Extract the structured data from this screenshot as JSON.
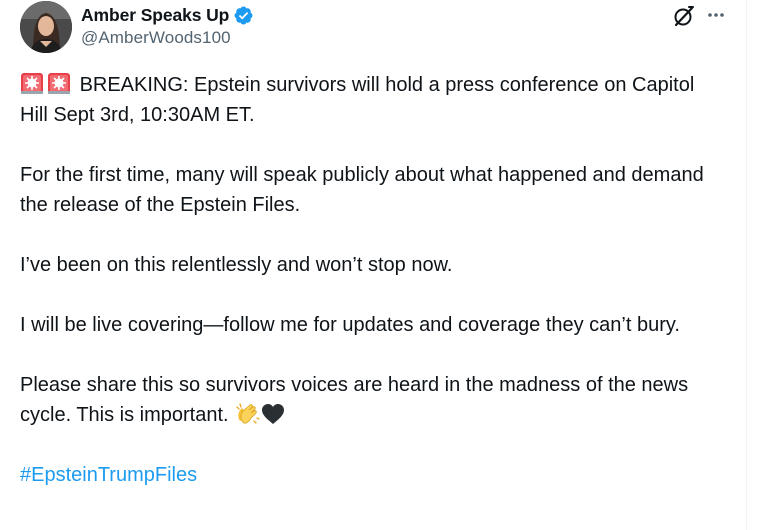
{
  "author": {
    "display_name": "Amber Speaks Up",
    "handle": "@AmberWoods100",
    "verified": true,
    "verified_color": "#1d9bf0"
  },
  "tweet": {
    "paragraphs": [
      "BREAKING: Epstein survivors will hold a press conference on Capitol Hill Sept 3rd, 10:30AM ET.",
      "For the first time, many will speak publicly about what happened and demand the release of the Epstein Files.",
      "I’ve been on this relentlessly and won’t stop now.",
      "I will be live covering—follow me for updates and coverage they can’t bury.",
      "Please share this so survivors voices are heard in the madness of the news cycle. This is important."
    ],
    "hashtag": "#EpsteinTrumpFiles",
    "leading_emoji": [
      "police-light-emoji",
      "police-light-emoji"
    ],
    "trailing_emoji": [
      "clapping-hands-emoji",
      "black-heart-emoji"
    ]
  },
  "icons": {
    "grok": "grok-icon",
    "more": "more-icon"
  },
  "colors": {
    "text": "#0f1419",
    "secondary": "#536471",
    "link": "#1d9bf0"
  }
}
